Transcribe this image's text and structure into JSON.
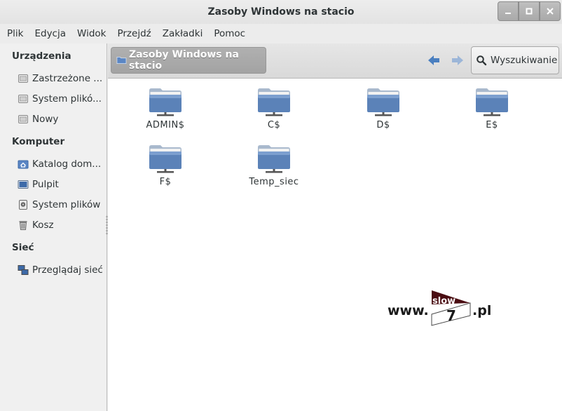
{
  "window": {
    "title": "Zasoby Windows na stacio"
  },
  "menubar": {
    "items": [
      "Plik",
      "Edycja",
      "Widok",
      "Przejdź",
      "Zakładki",
      "Pomoc"
    ]
  },
  "sidebar": {
    "sections": [
      {
        "heading": "Urządzenia",
        "items": [
          {
            "label": "Zastrzeżone ...",
            "icon": "drive-icon"
          },
          {
            "label": "System plikó...",
            "icon": "drive-icon"
          },
          {
            "label": "Nowy",
            "icon": "drive-icon"
          }
        ]
      },
      {
        "heading": "Komputer",
        "items": [
          {
            "label": "Katalog dom...",
            "icon": "home-folder-icon"
          },
          {
            "label": "Pulpit",
            "icon": "desktop-icon"
          },
          {
            "label": "System plików",
            "icon": "filesystem-icon"
          },
          {
            "label": "Kosz",
            "icon": "trash-icon"
          }
        ]
      },
      {
        "heading": "Sieć",
        "items": [
          {
            "label": "Przeglądaj sieć",
            "icon": "network-icon"
          }
        ]
      }
    ]
  },
  "toolbar": {
    "path_label": "Zasoby Windows na stacio",
    "search_label": "Wyszukiwanie"
  },
  "content": {
    "shares": [
      {
        "name": "ADMIN$"
      },
      {
        "name": "C$"
      },
      {
        "name": "D$"
      },
      {
        "name": "E$"
      },
      {
        "name": "F$"
      },
      {
        "name": "Temp_siec"
      }
    ]
  },
  "watermark": {
    "prefix": "www.",
    "word": "slow",
    "digit": "7",
    "suffix": ".pl"
  },
  "colors": {
    "folder_blue": "#5b82b8",
    "nav_arrow": "#4a7fc0",
    "title_text": "#2e3436"
  }
}
